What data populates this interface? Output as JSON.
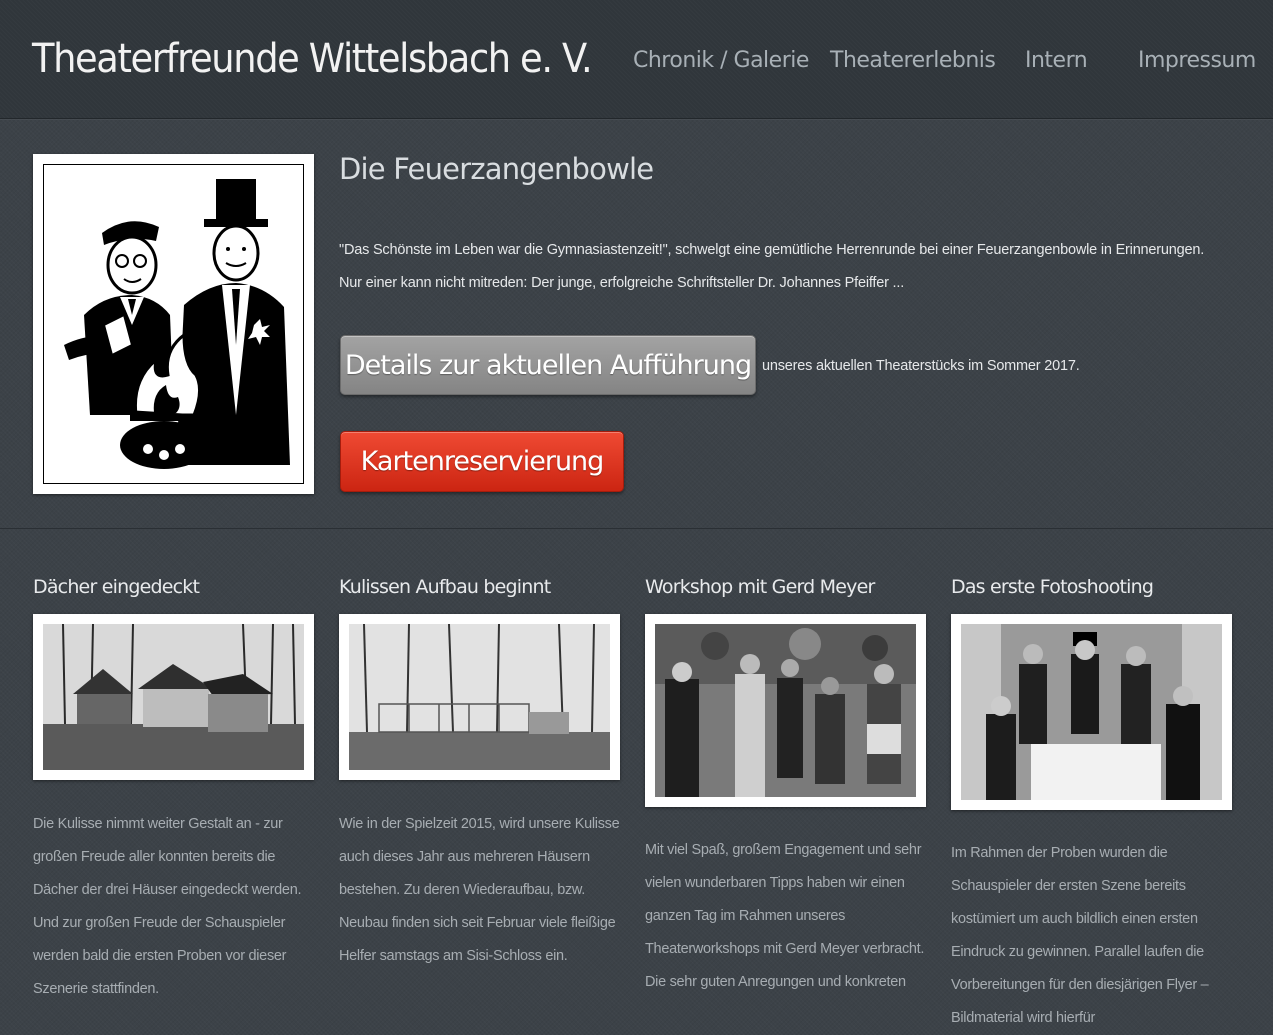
{
  "header": {
    "title": "Theaterfreunde Wittelsbach e. V.",
    "nav": [
      {
        "label": "Chronik / Galerie"
      },
      {
        "label": "Theatererlebnis"
      },
      {
        "label": "Intern"
      },
      {
        "label": "Impressum"
      }
    ]
  },
  "hero": {
    "title": "Die Feuerzangenbowle",
    "text": "\"Das Schönste im Leben war die Gymnasiastenzeit!\", schwelgt eine gemütliche Herrenrunde bei einer Feuerzangenbowle in Erinnerungen. Nur einer kann nicht mitreden: Der junge, erfolgreiche Schriftsteller Dr. Johannes Pfeiffer ...",
    "details_button": "Details zur aktuellen Aufführung",
    "details_suffix": "unseres aktuellen Theaterstücks im Sommer 2017.",
    "reserve_button": "Kartenreservierung"
  },
  "news": [
    {
      "title": "Dächer eingedeckt",
      "text": "Die Kulisse nimmt weiter Gestalt an - zur großen Freude aller konnten bereits die Dächer der drei Häuser eingedeckt werden. Und zur großen Freude der Schauspieler werden bald die ersten Proben vor dieser Szenerie stattfinden."
    },
    {
      "title": "Kulissen Aufbau beginnt",
      "text": "Wie in der Spielzeit 2015, wird unsere Kulisse auch dieses Jahr aus mehreren Häusern bestehen. Zu deren Wiederaufbau, bzw. Neubau finden sich seit Februar viele fleißige Helfer samstags am Sisi-Schloss ein."
    },
    {
      "title": "Workshop mit Gerd Meyer",
      "text": "Mit viel Spaß, großem Engagement und sehr vielen wunderbaren Tipps haben wir einen ganzen Tag im Rahmen unseres Theaterworkshops mit Gerd Meyer verbracht. Die sehr guten Anregungen und konkreten"
    },
    {
      "title": "Das erste Fotoshooting",
      "text": "Im Rahmen der Proben wurden die Schauspieler der ersten Szene bereits kostümiert um auch bildlich einen ersten Eindruck zu gewinnen. Parallel laufen die Vorbereitungen für den diesjärigen Flyer – Bildmaterial wird hierfür"
    }
  ]
}
